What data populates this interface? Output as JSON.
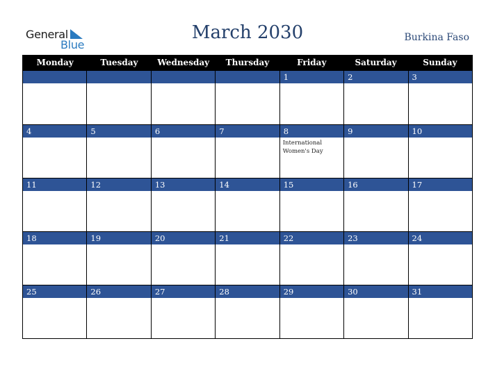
{
  "logo": {
    "general": "General",
    "blue": "Blue"
  },
  "title": "March 2030",
  "country": "Burkina Faso",
  "colors": {
    "header_bg": "#000000",
    "band_bg": "#2e5496",
    "title": "#24406b",
    "logo_blue": "#2b7bc0"
  },
  "weekdays": [
    "Monday",
    "Tuesday",
    "Wednesday",
    "Thursday",
    "Friday",
    "Saturday",
    "Sunday"
  ],
  "weeks": [
    [
      {
        "day": ""
      },
      {
        "day": ""
      },
      {
        "day": ""
      },
      {
        "day": ""
      },
      {
        "day": "1"
      },
      {
        "day": "2"
      },
      {
        "day": "3"
      }
    ],
    [
      {
        "day": "4"
      },
      {
        "day": "5"
      },
      {
        "day": "6"
      },
      {
        "day": "7"
      },
      {
        "day": "8",
        "event": "International Women's Day"
      },
      {
        "day": "9"
      },
      {
        "day": "10"
      }
    ],
    [
      {
        "day": "11"
      },
      {
        "day": "12"
      },
      {
        "day": "13"
      },
      {
        "day": "14"
      },
      {
        "day": "15"
      },
      {
        "day": "16"
      },
      {
        "day": "17"
      }
    ],
    [
      {
        "day": "18"
      },
      {
        "day": "19"
      },
      {
        "day": "20"
      },
      {
        "day": "21"
      },
      {
        "day": "22"
      },
      {
        "day": "23"
      },
      {
        "day": "24"
      }
    ],
    [
      {
        "day": "25"
      },
      {
        "day": "26"
      },
      {
        "day": "27"
      },
      {
        "day": "28"
      },
      {
        "day": "29"
      },
      {
        "day": "30"
      },
      {
        "day": "31"
      }
    ]
  ]
}
